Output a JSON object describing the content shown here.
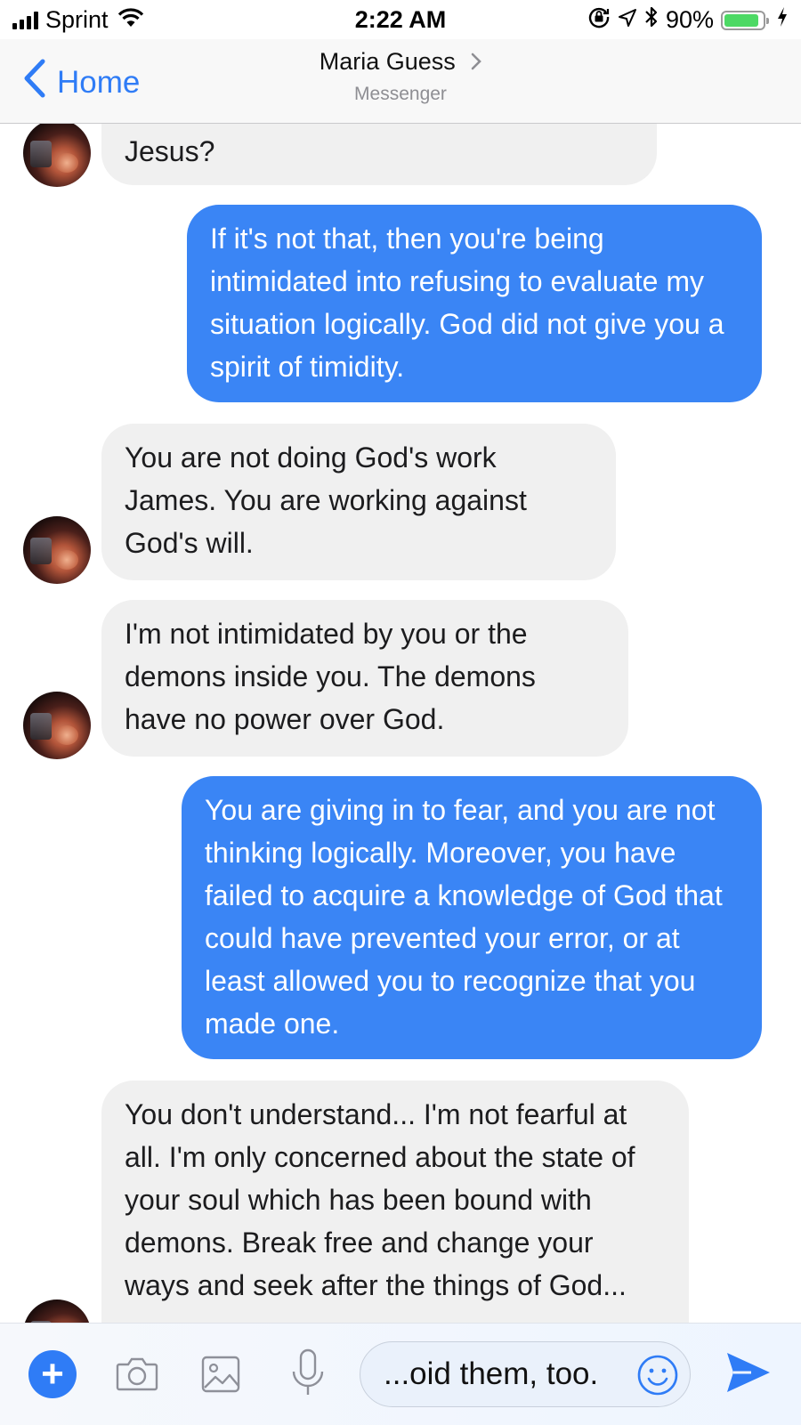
{
  "status_bar": {
    "carrier": "Sprint",
    "time": "2:22 AM",
    "battery_percent": "90%",
    "battery_level": 0.9
  },
  "nav": {
    "back_label": "Home",
    "contact_name": "Maria Guess",
    "subtitle": "Messenger"
  },
  "messages": [
    {
      "sender": "contact",
      "text": "Jesus?"
    },
    {
      "sender": "me",
      "text": "If it's not that, then you're being intimidated into refusing to evaluate my situation logically. God did not give you a spirit of  timidity."
    },
    {
      "sender": "contact",
      "text": "You are not doing God's work James. You are working against God's will."
    },
    {
      "sender": "contact",
      "text": "I'm not intimidated by you or the demons inside you. The demons have no power over God."
    },
    {
      "sender": "me",
      "text": "You are giving in to fear, and you are not thinking logically. Moreover, you have failed to acquire a knowledge of God that could have prevented your error, or at least allowed you to recognize that you made one."
    },
    {
      "sender": "contact",
      "text": "You don't understand... I'm not fearful at all. I'm only concerned about the state of your soul which has been bound with demons. Break free and change your ways and seek after the things of God..."
    }
  ],
  "composer": {
    "input_value": "...oid them, too."
  },
  "colors": {
    "accent": "#2f7cf6",
    "outgoing_bubble": "#3a85f5",
    "incoming_bubble": "#f0f0f0"
  },
  "icons": [
    "signal-icon",
    "wifi-icon",
    "lock-rotation-icon",
    "location-icon",
    "bluetooth-icon",
    "battery-icon",
    "charging-icon",
    "back-chevron-icon",
    "chevron-right-icon",
    "plus-icon",
    "camera-icon",
    "image-icon",
    "microphone-icon",
    "emoji-icon",
    "send-icon"
  ]
}
